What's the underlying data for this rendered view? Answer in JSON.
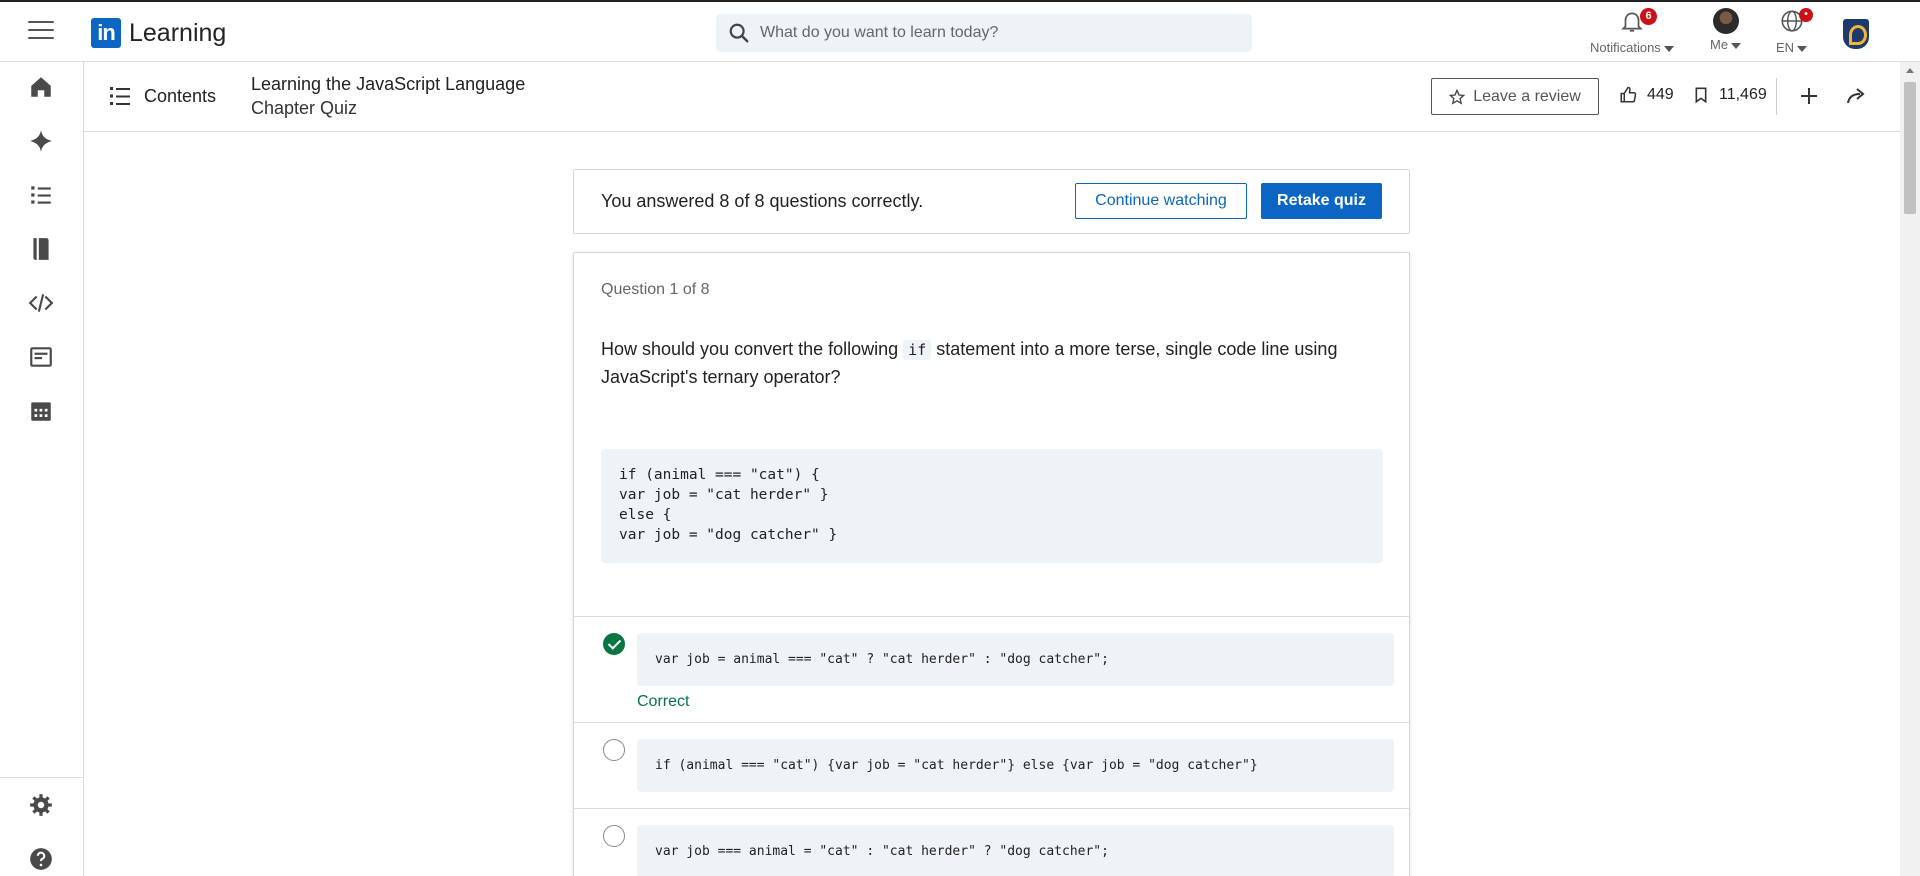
{
  "topbar": {
    "logo_mark": "in",
    "logo_text": "Learning",
    "search_placeholder": "What do you want to learn today?",
    "notifications_label": "Notifications",
    "notifications_count": "6",
    "me_label": "Me",
    "lang_label": "EN",
    "lang_badge": "•"
  },
  "course": {
    "contents_label": "Contents",
    "title": "Learning the JavaScript Language",
    "subtitle": "Chapter Quiz",
    "review_label": "Leave a review",
    "likes": "449",
    "saves": "11,469"
  },
  "result": {
    "text": "You answered 8 of 8 questions correctly.",
    "continue_label": "Continue watching",
    "retake_label": "Retake quiz"
  },
  "question": {
    "number_label": "Question 1 of 8",
    "text_before": "How should you convert the following ",
    "inline_code": "if",
    "text_after": " statement into a more terse, single code line using JavaScript's ternary operator?",
    "code": "if (animal === \"cat\") {\nvar job = \"cat herder\" }\nelse {\nvar job = \"dog catcher\" }"
  },
  "options": [
    {
      "code": "var job = animal === \"cat\" ? \"cat herder\" : \"dog catcher\";",
      "status": "Correct",
      "selected": true
    },
    {
      "code": "if (animal === \"cat\") {var job = \"cat herder\"} else {var job = \"dog catcher\"}",
      "status": "",
      "selected": false
    },
    {
      "code": "var job === animal = \"cat\" : \"cat herder\" ? \"dog catcher\";",
      "status": "",
      "selected": false
    }
  ],
  "colors": {
    "brand_blue": "#0a66c2",
    "correct_green": "#057642",
    "badge_red": "#cc1016"
  }
}
